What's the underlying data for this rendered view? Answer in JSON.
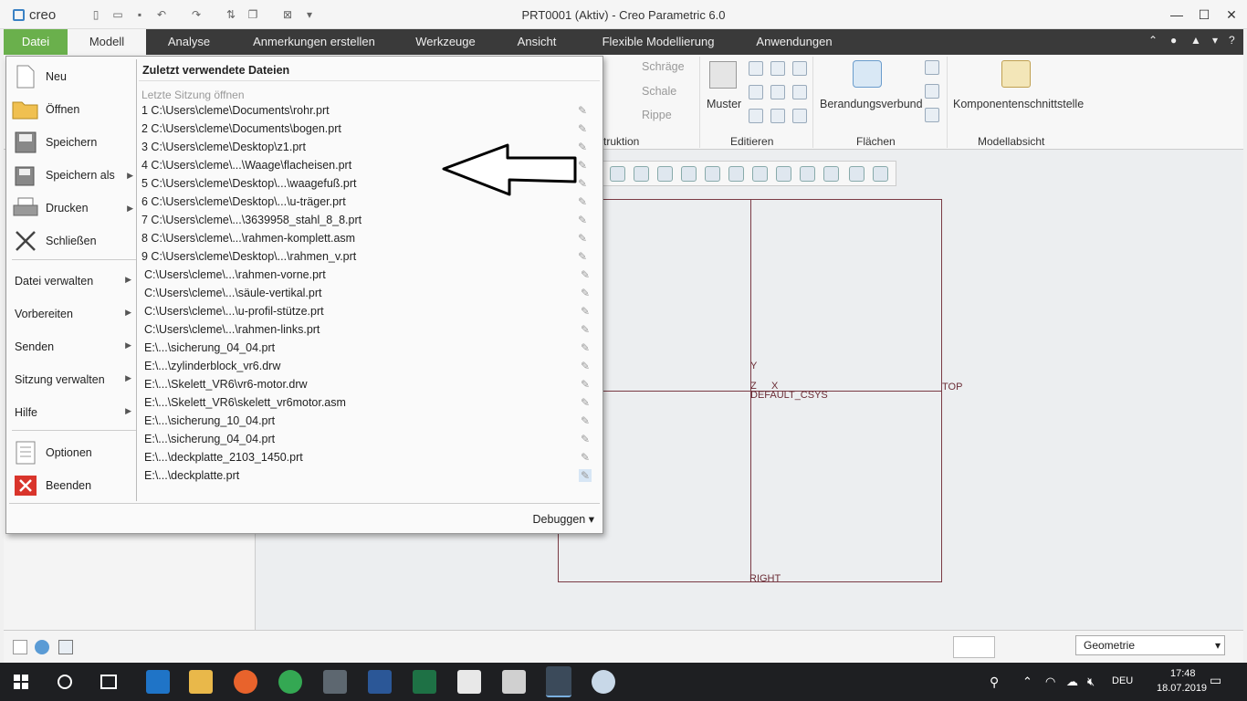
{
  "app": {
    "logo": "creo",
    "title": "PRT0001 (Aktiv) - Creo Parametric 6.0"
  },
  "menubar": {
    "tabs": [
      "Datei",
      "Modell",
      "Analyse",
      "Anmerkungen erstellen",
      "Werkzeuge",
      "Ansicht",
      "Flexible Modellierung",
      "Anwendungen"
    ]
  },
  "ribbon": {
    "items": {
      "schraege": "Schräge",
      "schale": "Schale",
      "rippe": "Rippe",
      "muster": "Muster",
      "berandung": "Berandungsverbund",
      "komponente": "Komponentenschnittstelle"
    },
    "groups": {
      "konstruktion": "truktion",
      "editieren": "Editieren",
      "flaechen": "Flächen",
      "modellabsicht": "Modellabsicht"
    }
  },
  "filemenu": {
    "main_items": [
      {
        "label": "Neu",
        "icon": "new-document-icon"
      },
      {
        "label": "Öffnen",
        "icon": "folder-open-icon"
      },
      {
        "label": "Speichern",
        "icon": "save-icon"
      },
      {
        "label": "Speichern als",
        "icon": "save-as-icon"
      },
      {
        "label": "Drucken",
        "icon": "printer-icon"
      },
      {
        "label": "Schließen",
        "icon": "close-x-icon"
      }
    ],
    "sub_items": [
      "Datei verwalten",
      "Vorbereiten",
      "Senden",
      "Sitzung verwalten",
      "Hilfe"
    ],
    "bottom_items": [
      {
        "label": "Optionen",
        "icon": "options-list-icon"
      },
      {
        "label": "Beenden",
        "icon": "exit-icon"
      }
    ],
    "recent_heading": "Zuletzt verwendete Dateien",
    "last_session": "Letzte Sitzung öffnen",
    "recent_files": [
      "1 C:\\Users\\cleme\\Documents\\rohr.prt",
      "2 C:\\Users\\cleme\\Documents\\bogen.prt",
      "3 C:\\Users\\cleme\\Desktop\\z1.prt",
      "4 C:\\Users\\cleme\\...\\Waage\\flacheisen.prt",
      "5 C:\\Users\\cleme\\Desktop\\...\\waagefuß.prt",
      "6 C:\\Users\\cleme\\Desktop\\...\\u-träger.prt",
      "7 C:\\Users\\cleme\\...\\3639958_stahl_8_8.prt",
      "8 C:\\Users\\cleme\\...\\rahmen-komplett.asm",
      "9 C:\\Users\\cleme\\Desktop\\...\\rahmen_v.prt",
      "C:\\Users\\cleme\\...\\rahmen-vorne.prt",
      "C:\\Users\\cleme\\...\\säule-vertikal.prt",
      "C:\\Users\\cleme\\...\\u-profil-stütze.prt",
      "C:\\Users\\cleme\\...\\rahmen-links.prt",
      "E:\\...\\sicherung_04_04.prt",
      "E:\\...\\zylinderblock_vr6.drw",
      "E:\\...\\Skelett_VR6\\vr6-motor.drw",
      "E:\\...\\Skelett_VR6\\skelett_vr6motor.asm",
      "E:\\...\\sicherung_10_04.prt",
      "E:\\...\\sicherung_04_04.prt",
      "E:\\...\\deckplatte_2103_1450.prt",
      "E:\\...\\deckplatte.prt"
    ],
    "debug": "Debuggen"
  },
  "graphics": {
    "datum_y": "Y",
    "datum_z": "Z",
    "datum_x": "X",
    "csys": "DEFAULT_CSYS",
    "top": "TOP",
    "right": "RIGHT"
  },
  "statusbar": {
    "filter": "Geometrie"
  },
  "taskbar": {
    "lang": "DEU",
    "time": "17:48",
    "date": "18.07.2019"
  },
  "colors": {
    "datei_tab": "#6ab04c",
    "menubar": "#3a3a3a",
    "datum": "#7a3a44"
  }
}
